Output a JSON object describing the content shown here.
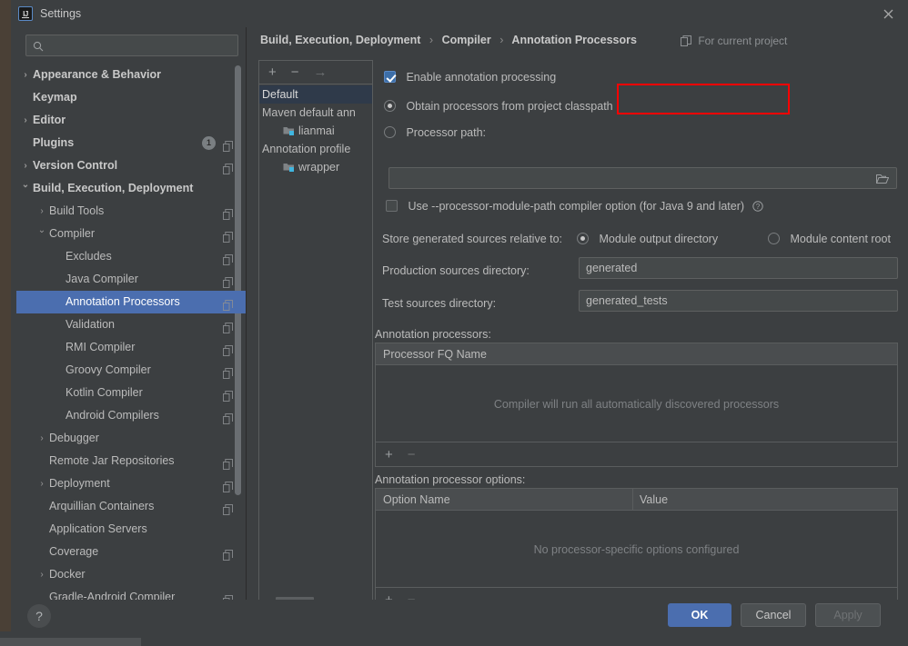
{
  "window": {
    "title": "Settings",
    "app_icon": "intellij-idea-icon",
    "close_icon": "close-icon"
  },
  "search": {
    "value": "",
    "placeholder": "",
    "icon": "search-icon"
  },
  "sidebar": {
    "items": [
      {
        "label": "Appearance & Behavior",
        "level": 0,
        "arrow": "collapsed",
        "bold": true,
        "copy": false,
        "badge": null
      },
      {
        "label": "Keymap",
        "level": 0,
        "arrow": "none",
        "bold": true,
        "copy": false,
        "badge": null
      },
      {
        "label": "Editor",
        "level": 0,
        "arrow": "collapsed",
        "bold": true,
        "copy": false,
        "badge": null
      },
      {
        "label": "Plugins",
        "level": 0,
        "arrow": "none",
        "bold": true,
        "copy": true,
        "badge": "1"
      },
      {
        "label": "Version Control",
        "level": 0,
        "arrow": "collapsed",
        "bold": true,
        "copy": true,
        "badge": null
      },
      {
        "label": "Build, Execution, Deployment",
        "level": 0,
        "arrow": "expanded",
        "bold": true,
        "copy": false,
        "badge": null
      },
      {
        "label": "Build Tools",
        "level": 1,
        "arrow": "collapsed",
        "bold": false,
        "copy": true,
        "badge": null
      },
      {
        "label": "Compiler",
        "level": 1,
        "arrow": "expanded",
        "bold": false,
        "copy": true,
        "badge": null
      },
      {
        "label": "Excludes",
        "level": 2,
        "arrow": "none",
        "bold": false,
        "copy": true,
        "badge": null
      },
      {
        "label": "Java Compiler",
        "level": 2,
        "arrow": "none",
        "bold": false,
        "copy": true,
        "badge": null
      },
      {
        "label": "Annotation Processors",
        "level": 2,
        "arrow": "none",
        "bold": false,
        "copy": true,
        "badge": null,
        "selected": true
      },
      {
        "label": "Validation",
        "level": 2,
        "arrow": "none",
        "bold": false,
        "copy": true,
        "badge": null
      },
      {
        "label": "RMI Compiler",
        "level": 2,
        "arrow": "none",
        "bold": false,
        "copy": true,
        "badge": null
      },
      {
        "label": "Groovy Compiler",
        "level": 2,
        "arrow": "none",
        "bold": false,
        "copy": true,
        "badge": null
      },
      {
        "label": "Kotlin Compiler",
        "level": 2,
        "arrow": "none",
        "bold": false,
        "copy": true,
        "badge": null
      },
      {
        "label": "Android Compilers",
        "level": 2,
        "arrow": "none",
        "bold": false,
        "copy": true,
        "badge": null
      },
      {
        "label": "Debugger",
        "level": 1,
        "arrow": "collapsed",
        "bold": false,
        "copy": false,
        "badge": null
      },
      {
        "label": "Remote Jar Repositories",
        "level": 1,
        "arrow": "none",
        "bold": false,
        "copy": true,
        "badge": null
      },
      {
        "label": "Deployment",
        "level": 1,
        "arrow": "collapsed",
        "bold": false,
        "copy": true,
        "badge": null
      },
      {
        "label": "Arquillian Containers",
        "level": 1,
        "arrow": "none",
        "bold": false,
        "copy": true,
        "badge": null
      },
      {
        "label": "Application Servers",
        "level": 1,
        "arrow": "none",
        "bold": false,
        "copy": false,
        "badge": null
      },
      {
        "label": "Coverage",
        "level": 1,
        "arrow": "none",
        "bold": false,
        "copy": true,
        "badge": null
      },
      {
        "label": "Docker",
        "level": 1,
        "arrow": "collapsed",
        "bold": false,
        "copy": false,
        "badge": null
      },
      {
        "label": "Gradle-Android Compiler",
        "level": 1,
        "arrow": "none",
        "bold": false,
        "copy": true,
        "badge": null
      }
    ]
  },
  "breadcrumb": {
    "part1": "Build, Execution, Deployment",
    "part2": "Compiler",
    "part3": "Annotation Processors",
    "separator": "›",
    "for_project": "For current project",
    "for_project_icon": "copy-project-icon"
  },
  "profiles": {
    "toolbar": {
      "add": "+",
      "remove": "−",
      "move": "→"
    },
    "items": [
      {
        "label": "Default",
        "type": "profile",
        "selected": true
      },
      {
        "label": "Maven default ann",
        "type": "profile",
        "selected": false
      },
      {
        "label": "lianmai",
        "type": "module",
        "selected": false
      },
      {
        "label": "Annotation profile",
        "type": "profile",
        "selected": false
      },
      {
        "label": "wrapper",
        "type": "module",
        "selected": false
      }
    ]
  },
  "settings": {
    "enable_annotation_processing": {
      "label": "Enable annotation processing",
      "checked": true,
      "highlighted": true
    },
    "source_mode": {
      "classpath": {
        "label": "Obtain processors from project classpath",
        "checked": true
      },
      "processor_path": {
        "label": "Processor path:",
        "checked": false
      },
      "processor_path_value": "",
      "browse_icon": "folder-browse-icon"
    },
    "module_path_option": {
      "label": "Use --processor-module-path compiler option (for Java 9 and later)",
      "checked": false,
      "help_icon": "help-circle-icon"
    },
    "store_relative": {
      "label": "Store generated sources relative to:",
      "option_output": {
        "label": "Module output directory",
        "checked": true
      },
      "option_content": {
        "label": "Module content root",
        "checked": false
      }
    },
    "production_sources": {
      "label": "Production sources directory:",
      "value": "generated"
    },
    "test_sources": {
      "label": "Test sources directory:",
      "value": "generated_tests"
    },
    "processors_table": {
      "label": "Annotation processors:",
      "columns": [
        "Processor FQ Name"
      ],
      "rows": [],
      "empty_message": "Compiler will run all automatically discovered processors",
      "add": "+",
      "remove": "−"
    },
    "options_table": {
      "label": "Annotation processor options:",
      "columns": [
        "Option Name",
        "Value"
      ],
      "rows": [],
      "empty_message": "No processor-specific options configured",
      "add": "+",
      "remove": "−"
    }
  },
  "footer": {
    "help": "?",
    "ok": "OK",
    "cancel": "Cancel",
    "apply": "Apply"
  },
  "colors": {
    "window_bg": "#3c3f41",
    "selection": "#4b6eaf",
    "accent_red": "#ff0000",
    "field_bg": "#45494a",
    "text": "#bbbbbb"
  }
}
